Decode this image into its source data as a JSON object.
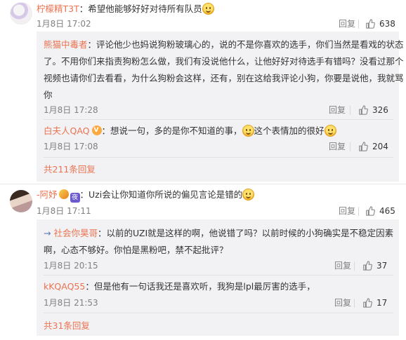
{
  "comments": [
    {
      "user": "柠檬精T3T",
      "text": "：希望他能够好好对待所有队员",
      "time": "1月8日 17:02",
      "reply_label": "回复",
      "likes": "638",
      "replies": [
        {
          "user": "熊猫中毒者",
          "text_lines": [
            "：评论他少也妈说狗粉玻璃心的，说的不是你喜欢的选手，你们当然是看戏的状态",
            "了。不用你们来指责狗粉怎么做，我们有没说他什么，让他好好对待选手有错吗？没看过那个",
            "视频也请你们去看看，为什么狗粉会这样，还有，别在这给我评论小狗，你要是说他，我就骂",
            "你"
          ],
          "time": "1月8日 17:28",
          "reply_label": "回复",
          "likes": "326"
        },
        {
          "user": "白夫人QAQ",
          "text_a": "：想说一句，多的是你不知道的事，",
          "text_b": "这个表情加的很好",
          "time": "1月8日 17:08",
          "reply_label": "回复",
          "likes": "204"
        }
      ],
      "more_label": "共211条回复"
    },
    {
      "user": "-阿妤",
      "badge2_text": "夜",
      "text": "：Uzi会让你知道你所说的偏见言论是错的",
      "time": "1月8日 17:11",
      "reply_label": "回复",
      "likes": "465",
      "replies": [
        {
          "prefix": "→",
          "user": "社会你昊哥",
          "text_lines": [
            "：以前的UZI就是这样的啊，他说错了吗？以前时候的小狗确实是不稳定因素",
            "啊，心态不够好。你怕是黑粉吧，禁不起批评？"
          ],
          "time": "1月8日 20:15",
          "reply_label": "回复",
          "likes": "37"
        },
        {
          "user": "kKQAQ55",
          "text": "：但是他有一句话我还是喜欢听，我狗是lpl最厉害的选手，",
          "time": "1月8日 21:53",
          "reply_label": "回复",
          "likes": "17"
        }
      ],
      "more_label": "共31条回复"
    }
  ]
}
